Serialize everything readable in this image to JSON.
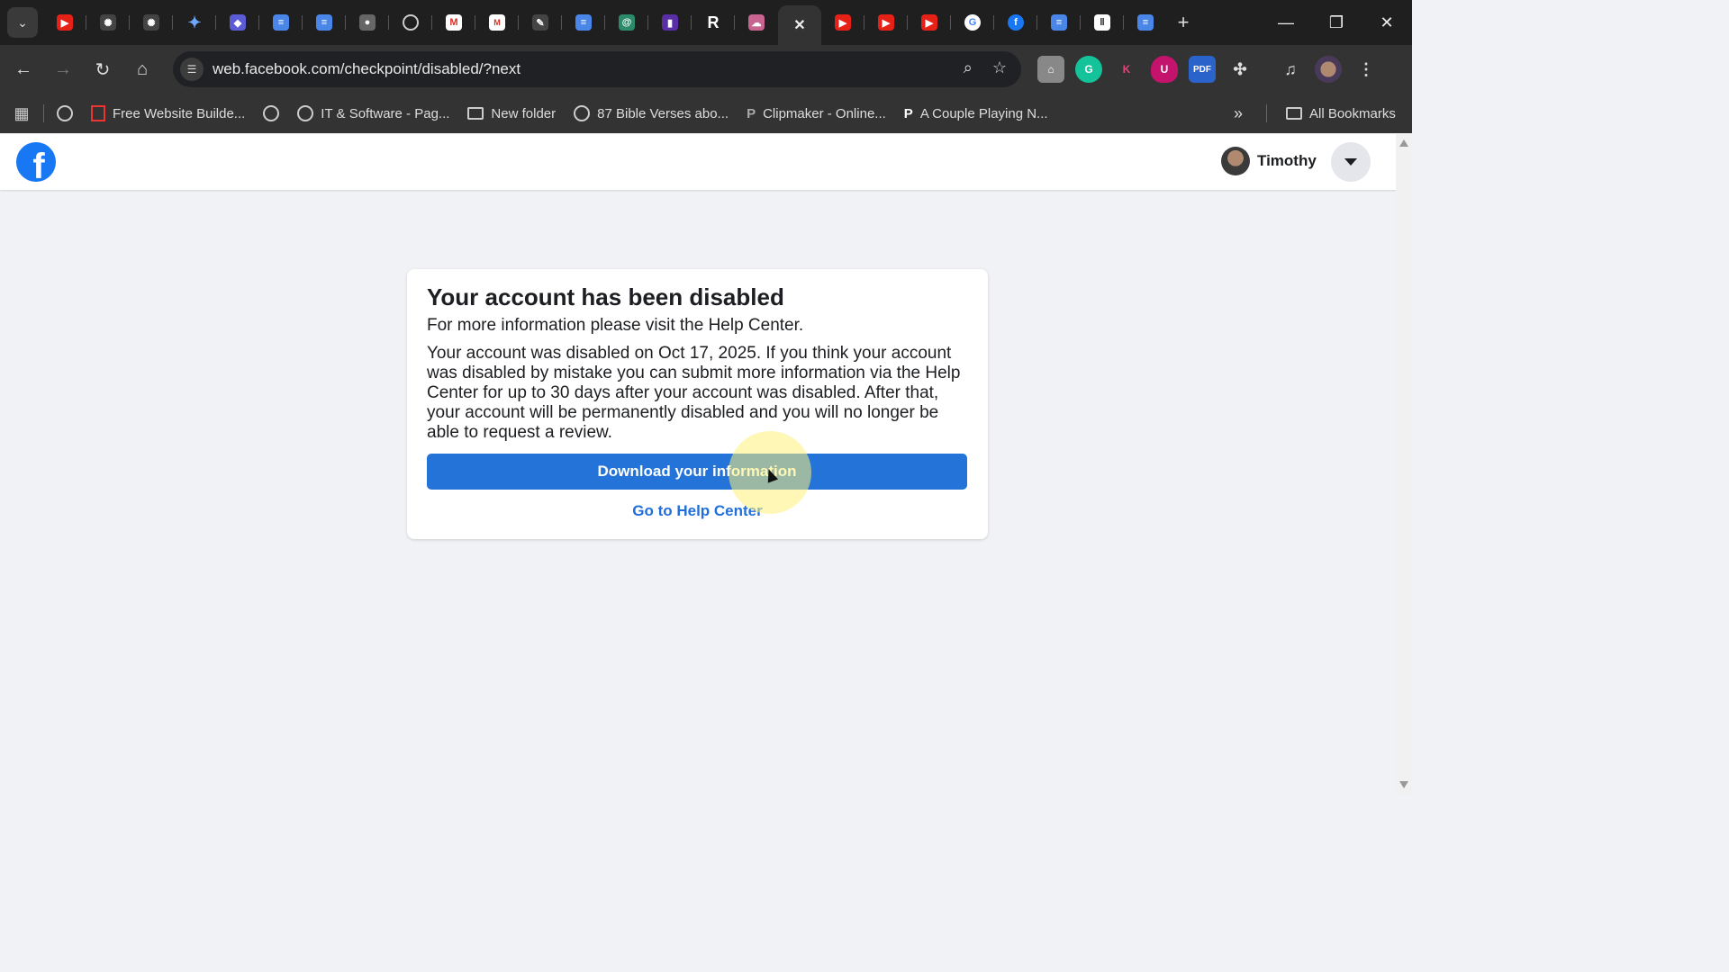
{
  "browser": {
    "active_tab_close": "✕",
    "new_tab": "+",
    "url": "web.facebook.com/checkpoint/disabled/?next",
    "window_controls": {
      "minimize": "—",
      "restore": "❐",
      "close": "✕"
    }
  },
  "bookmarks": [
    {
      "label": "Free Website Builde...",
      "icon": "red-square-icon"
    },
    {
      "label": "IT & Software - Pag...",
      "icon": "globe-icon"
    },
    {
      "label": "New folder",
      "icon": "folder-icon"
    },
    {
      "label": "87 Bible Verses abo...",
      "icon": "globe-icon"
    },
    {
      "label": "Clipmaker - Online...",
      "icon": "p-logo-icon"
    },
    {
      "label": "A Couple Playing N...",
      "icon": "p-logo-icon"
    }
  ],
  "bookmarks_overflow": "»",
  "all_bookmarks": "All Bookmarks",
  "extensions": {
    "pdf": "PDF",
    "k": "K",
    "u": "U"
  },
  "facebook": {
    "profile_name": "Timothy",
    "logo_letter": "f"
  },
  "card": {
    "title": "Your account has been disabled",
    "subtitle": "For more information please visit the Help Center.",
    "body": "Your account was disabled on Oct 17, 2025. If you think your account was disabled by mistake you can submit more information via the Help Center for up to 30 days after your account was disabled. After that, your account will be permanently disabled and you will no longer be able to request a review.",
    "download_button": "Download your information",
    "help_link": "Go to Help Center"
  },
  "colors": {
    "facebook_blue": "#1877f2",
    "button_blue": "#2373d9",
    "link_blue": "#216fdb",
    "page_bg": "#f0f2f5"
  }
}
